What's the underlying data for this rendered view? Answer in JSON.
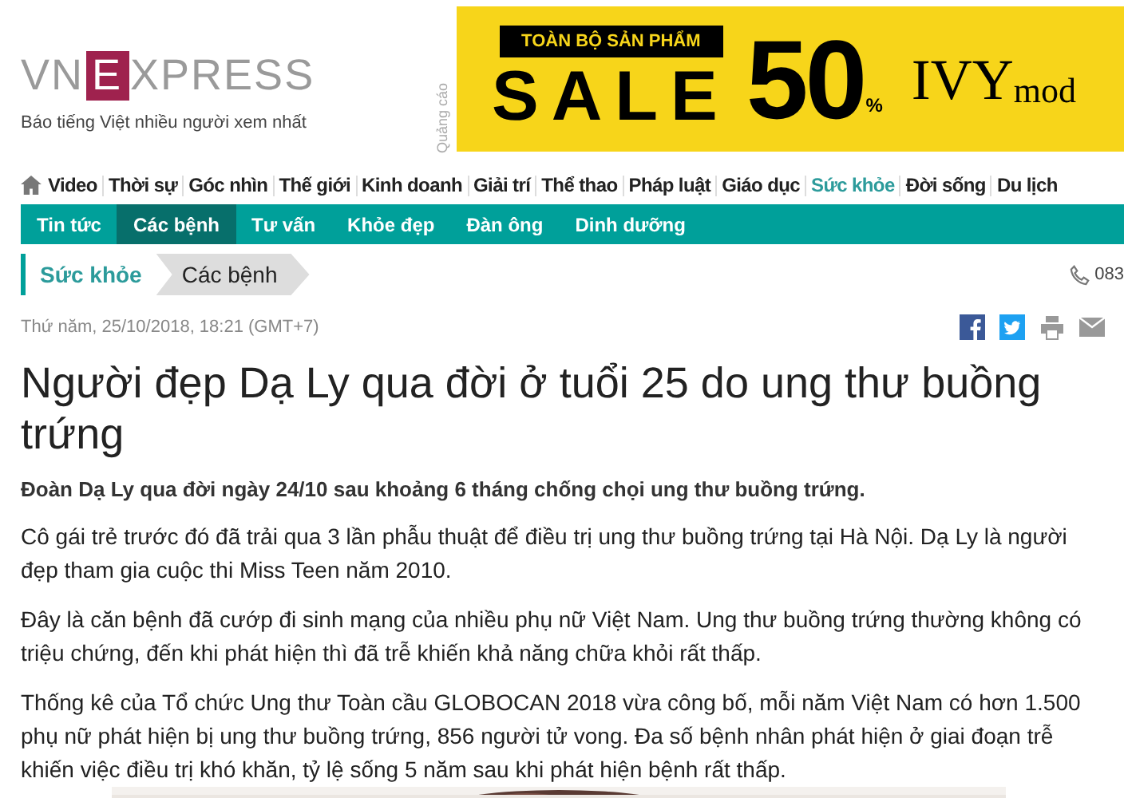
{
  "logo": {
    "prefix": "VN",
    "mark": "E",
    "suffix": "XPRESS",
    "tagline": "Báo tiếng Việt nhiều người xem nhất"
  },
  "ad": {
    "label": "Quảng cáo",
    "banner": "TOÀN BỘ SẢN PHẨM",
    "headline": "SALE",
    "number": "50",
    "unit": "%",
    "brand": "IVY",
    "brand_suffix": "mod"
  },
  "nav": [
    {
      "label": "Video",
      "selected": false
    },
    {
      "label": "Thời sự",
      "selected": false
    },
    {
      "label": "Góc nhìn",
      "selected": false
    },
    {
      "label": "Thế giới",
      "selected": false
    },
    {
      "label": "Kinh doanh",
      "selected": false
    },
    {
      "label": "Giải trí",
      "selected": false
    },
    {
      "label": "Thể thao",
      "selected": false
    },
    {
      "label": "Pháp luật",
      "selected": false
    },
    {
      "label": "Giáo dục",
      "selected": false
    },
    {
      "label": "Sức khỏe",
      "selected": true
    },
    {
      "label": "Đời sống",
      "selected": false
    },
    {
      "label": "Du lịch",
      "selected": false
    }
  ],
  "subnav": [
    {
      "label": "Tin tức",
      "selected": false
    },
    {
      "label": "Các bệnh",
      "selected": true
    },
    {
      "label": "Tư vấn",
      "selected": false
    },
    {
      "label": "Khỏe đẹp",
      "selected": false
    },
    {
      "label": "Đàn ông",
      "selected": false
    },
    {
      "label": "Dinh dưỡng",
      "selected": false
    }
  ],
  "breadcrumb": [
    "Sức khỏe",
    "Các bệnh"
  ],
  "hotline": "083",
  "article": {
    "date": "Thứ năm, 25/10/2018, 18:21 (GMT+7)",
    "title": "Người đẹp Dạ Ly qua đời ở tuổi 25 do ung thư buồng trứng",
    "lead": "Đoàn Dạ Ly qua đời ngày 24/10 sau khoảng 6 tháng chống chọi ung thư buồng trứng.",
    "paragraphs": [
      "Cô gái trẻ trước đó đã trải qua 3 lần phẫu thuật để điều trị ung thư buồng trứng tại Hà Nội. Dạ Ly là người đẹp tham gia cuộc thi Miss Teen năm 2010.",
      "Đây là căn bệnh đã cướp đi sinh mạng của nhiều phụ nữ Việt Nam. Ung thư buồng trứng thường không có triệu chứng, đến khi phát hiện thì đã trễ khiến khả năng chữa khỏi rất thấp.",
      "Thống kê của Tổ chức Ung thư Toàn cầu GLOBOCAN 2018 vừa công bố, mỗi năm Việt Nam có hơn 1.500 phụ nữ phát hiện bị ung thư buồng trứng, 856 người tử vong. Đa số bệnh nhân phát hiện ở giai đoạn trễ khiến việc điều trị khó khăn, tỷ lệ sống 5 năm sau khi phát hiện bệnh rất thấp."
    ]
  }
}
